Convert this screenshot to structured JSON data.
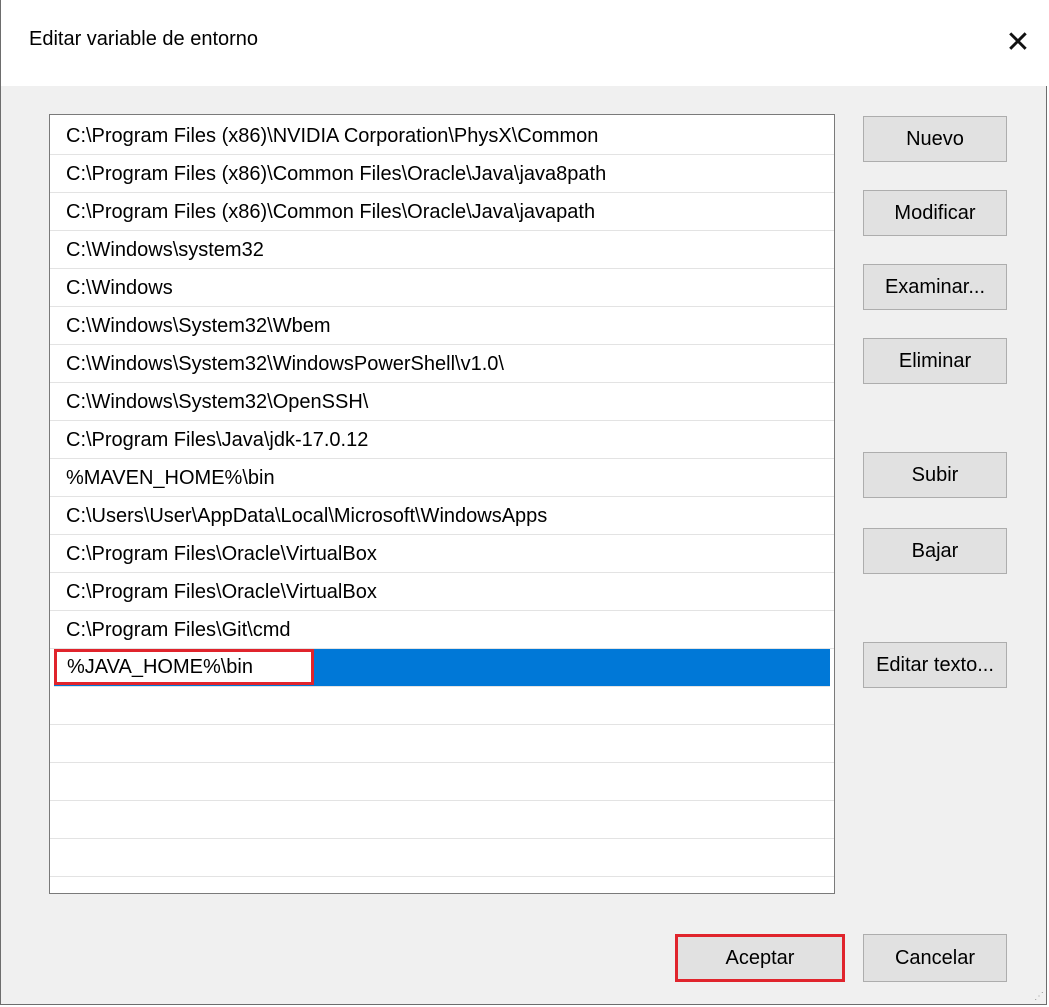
{
  "window": {
    "title": "Editar variable de entorno",
    "close_glyph": "✕"
  },
  "path_list": {
    "items": [
      "C:\\Program Files (x86)\\NVIDIA Corporation\\PhysX\\Common",
      "C:\\Program Files (x86)\\Common Files\\Oracle\\Java\\java8path",
      "C:\\Program Files (x86)\\Common Files\\Oracle\\Java\\javapath",
      "C:\\Windows\\system32",
      "C:\\Windows",
      "C:\\Windows\\System32\\Wbem",
      "C:\\Windows\\System32\\WindowsPowerShell\\v1.0\\",
      "C:\\Windows\\System32\\OpenSSH\\",
      "C:\\Program Files\\Java\\jdk-17.0.12",
      "%MAVEN_HOME%\\bin",
      "C:\\Users\\User\\AppData\\Local\\Microsoft\\WindowsApps",
      "C:\\Program Files\\Oracle\\VirtualBox",
      "C:\\Program Files\\Oracle\\VirtualBox",
      "C:\\Program Files\\Git\\cmd"
    ],
    "editing_value": "%JAVA_HOME%\\bin",
    "empty_rows": 6
  },
  "buttons": {
    "nuevo": "Nuevo",
    "modificar": "Modificar",
    "examinar": "Examinar...",
    "eliminar": "Eliminar",
    "subir": "Subir",
    "bajar": "Bajar",
    "editar_texto": "Editar texto...",
    "aceptar": "Aceptar",
    "cancelar": "Cancelar"
  },
  "colors": {
    "selection": "#0078d7",
    "highlight_border": "#e0242c",
    "button_face": "#e1e1e1",
    "dialog_background": "#f0f0f0"
  }
}
